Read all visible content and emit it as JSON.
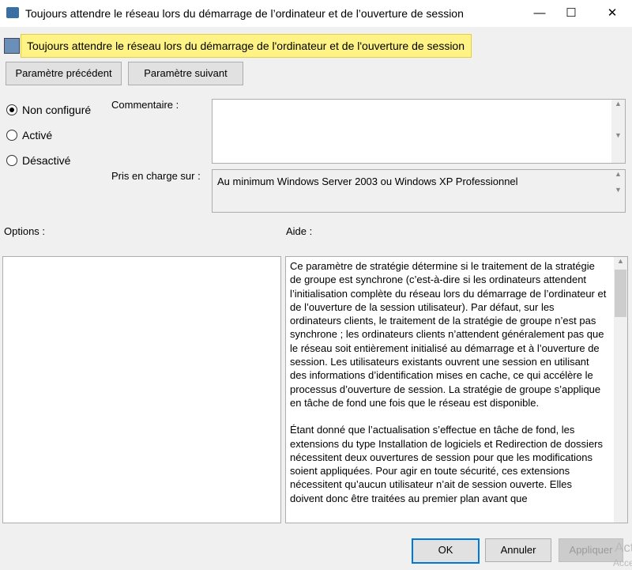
{
  "window": {
    "title": "Toujours attendre le réseau lors du démarrage de l’ordinateur et de l’ouverture de session",
    "minimize": "—",
    "maximize": "☐",
    "close": "✕"
  },
  "banner": {
    "text": "Toujours attendre le réseau lors du démarrage de l'ordinateur et de l'ouverture de session"
  },
  "nav": {
    "prev": "Paramètre précédent",
    "next": "Paramètre suivant"
  },
  "state": {
    "options": [
      "Non configuré",
      "Activé",
      "Désactivé"
    ],
    "selected": 0
  },
  "comment": {
    "label": "Commentaire :",
    "value": ""
  },
  "supported": {
    "label": "Pris en charge sur :",
    "value": "Au minimum Windows Server 2003 ou Windows XP Professionnel"
  },
  "options_label": "Options :",
  "help_label": "Aide :",
  "help": {
    "p1": "Ce paramètre de stratégie détermine si le traitement de la stratégie de groupe est synchrone (c’est-à-dire si les ordinateurs attendent l’initialisation complète du réseau lors du démarrage de l’ordinateur et de l’ouverture de la session utilisateur). Par défaut, sur les ordinateurs clients, le traitement de la stratégie de groupe n’est pas synchrone ; les ordinateurs clients n’attendent généralement pas que le réseau soit entièrement initialisé au démarrage et à l’ouverture de session. Les utilisateurs existants ouvrent une session en utilisant des informations d’identification mises en cache, ce qui accélère le processus d’ouverture de session. La stratégie de groupe s’applique en tâche de fond une fois que le réseau est disponible.",
    "p2": "Étant donné que l’actualisation s’effectue en tâche de fond, les extensions du type Installation de logiciels et Redirection de dossiers nécessitent deux ouvertures de session pour que les modifications soient appliquées. Pour agir en toute sécurité, ces extensions nécessitent qu’aucun utilisateur n’ait de session ouverte. Elles doivent donc être traitées au premier plan avant que"
  },
  "footer": {
    "ok": "OK",
    "cancel": "Annuler",
    "apply": "Appliquer"
  },
  "watermark": {
    "line1": "Act",
    "line2": "Acce"
  }
}
